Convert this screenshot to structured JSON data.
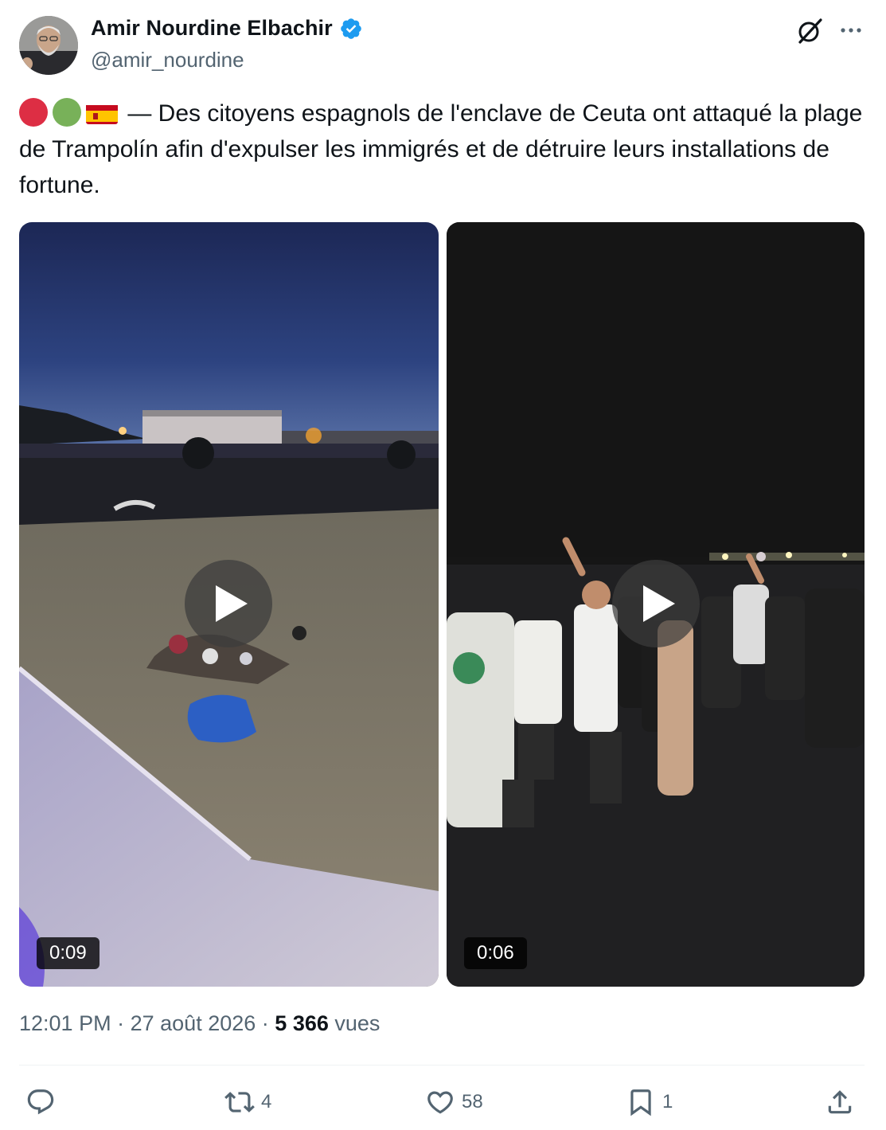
{
  "author": {
    "display_name": "Amir Nourdine Elbachir",
    "handle": "@amir_nourdine",
    "verified_icon": "verified-badge-icon"
  },
  "tweet": {
    "text": "— Des citoyens espagnols de l'enclave de Ceuta ont attaqué la plage de Trampolín afin d'expulser les immigrés et de détruire leurs installations de fortune.",
    "emojis": [
      "red-circle-emoji",
      "green-circle-emoji",
      "spain-flag-emoji"
    ]
  },
  "media": {
    "videos": [
      {
        "duration": "0:09"
      },
      {
        "duration": "0:06"
      }
    ]
  },
  "meta": {
    "time": "12:01 PM",
    "separator": "·",
    "date": "27 août 2026",
    "views_count": "5 366",
    "views_label": "vues"
  },
  "actions": {
    "reply_count": "",
    "retweet_count": "4",
    "like_count": "58",
    "bookmark_count": "1"
  },
  "colors": {
    "text_primary": "#0f1419",
    "text_secondary": "#536471",
    "verified_blue": "#1d9bf0",
    "divider": "#eff3f4"
  }
}
